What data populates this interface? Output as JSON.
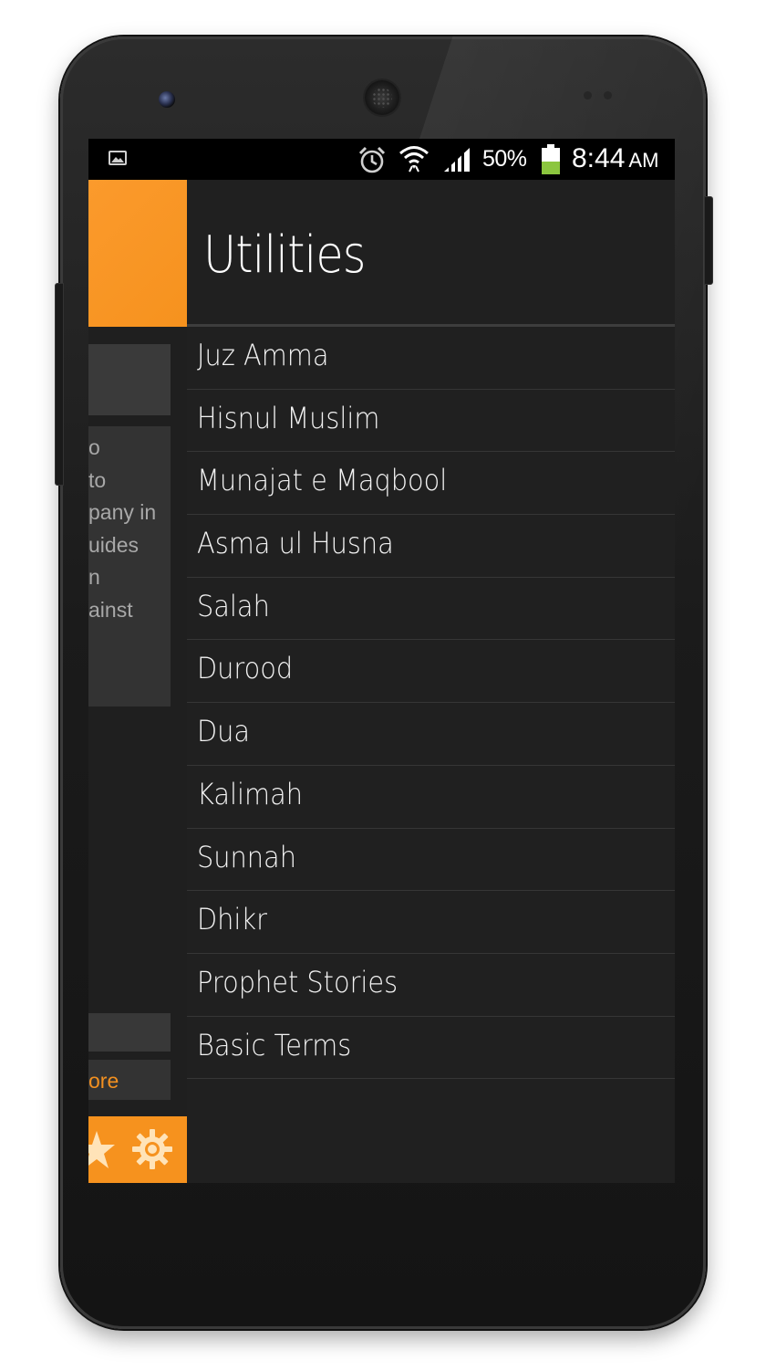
{
  "status_bar": {
    "battery_percent": "50%",
    "time": "8:44",
    "ampm": "AM",
    "battery_level": 0.5,
    "icons": [
      "picture-icon",
      "alarm-icon",
      "wifi-icon",
      "signal-icon",
      "battery-icon"
    ]
  },
  "background_panel": {
    "text_fragments": [
      "o",
      "to",
      "pany in",
      "uides",
      "n",
      "ainst"
    ],
    "more_link": "ore",
    "bottom_icons": [
      "star-icon",
      "gear-icon"
    ]
  },
  "drawer": {
    "title": "Utilities",
    "items": [
      {
        "label": "Juz Amma"
      },
      {
        "label": "Hisnul Muslim"
      },
      {
        "label": "Munajat e Maqbool"
      },
      {
        "label": "Asma ul Husna"
      },
      {
        "label": "Salah"
      },
      {
        "label": "Durood"
      },
      {
        "label": "Dua"
      },
      {
        "label": "Kalimah"
      },
      {
        "label": "Sunnah"
      },
      {
        "label": "Dhikr"
      },
      {
        "label": "Prophet Stories"
      },
      {
        "label": "Basic Terms"
      }
    ]
  },
  "colors": {
    "accent": "#F6921E",
    "background": "#1F1F1F",
    "text": "#F2F2F2",
    "status_bar": "#000000"
  }
}
